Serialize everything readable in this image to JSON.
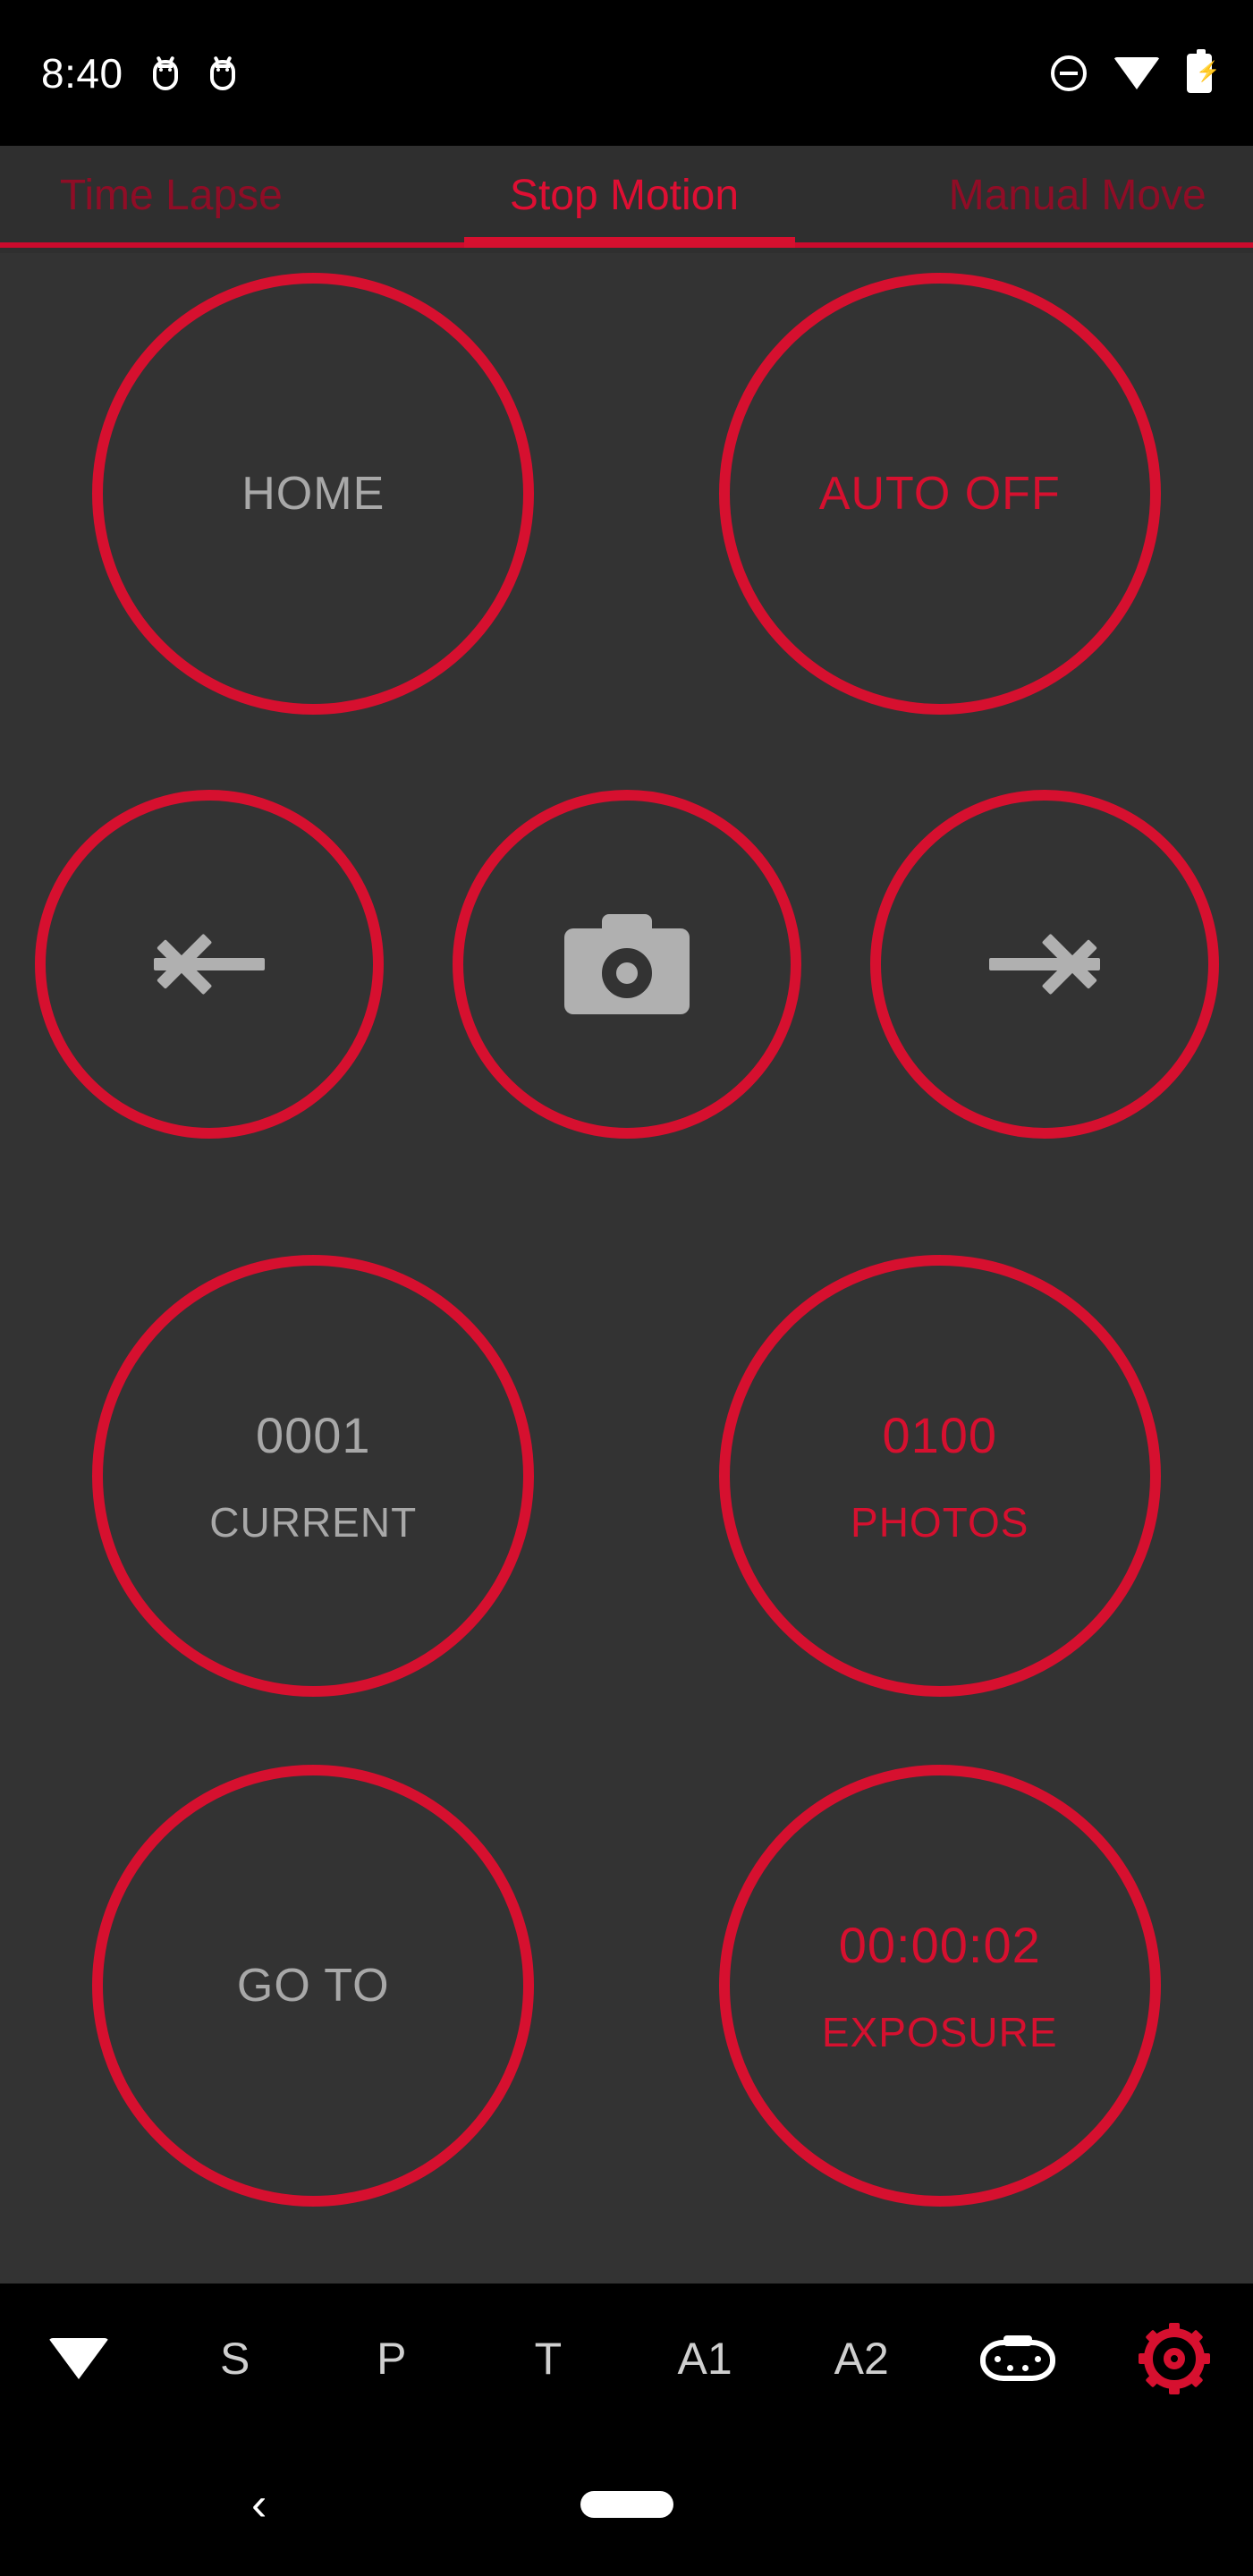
{
  "status_bar": {
    "time": "8:40",
    "left_icons": [
      "android-notification-icon",
      "android-notification-icon"
    ],
    "right_icons": [
      "do-not-disturb-icon",
      "wifi-icon",
      "battery-charging-icon"
    ]
  },
  "tabs": {
    "items": [
      {
        "label": "Time Lapse",
        "active": false
      },
      {
        "label": "Stop Motion",
        "active": true
      },
      {
        "label": "Manual Move",
        "active": false
      }
    ],
    "active_index": 1
  },
  "controls": {
    "home": {
      "label": "HOME"
    },
    "auto": {
      "label": "AUTO OFF"
    },
    "prev": {
      "icon": "arrow-left-icon"
    },
    "shutter": {
      "icon": "camera-icon"
    },
    "next": {
      "icon": "arrow-right-icon"
    },
    "current": {
      "value": "0001",
      "label": "CURRENT"
    },
    "photos": {
      "value": "0100",
      "label": "PHOTOS"
    },
    "goto": {
      "label": "GO TO"
    },
    "exposure": {
      "value": "00:00:02",
      "label": "EXPOSURE"
    }
  },
  "app_bar": {
    "items": [
      {
        "type": "icon",
        "name": "wifi-icon",
        "label": ""
      },
      {
        "type": "text",
        "name": "s-button",
        "label": "S"
      },
      {
        "type": "text",
        "name": "p-button",
        "label": "P"
      },
      {
        "type": "text",
        "name": "t-button",
        "label": "T"
      },
      {
        "type": "text",
        "name": "a1-button",
        "label": "A1"
      },
      {
        "type": "text",
        "name": "a2-button",
        "label": "A2"
      },
      {
        "type": "icon",
        "name": "gamepad-icon",
        "label": ""
      },
      {
        "type": "icon",
        "name": "settings-gear-icon",
        "label": ""
      }
    ]
  },
  "nav_bar": {
    "back_glyph": "‹",
    "home_indicator": "home-pill"
  },
  "colors": {
    "accent_red": "#d6102f",
    "inactive_red": "#8f0d26",
    "background": "#333333",
    "tab_background": "#2f2f2f",
    "text_gray": "#a8a8a8",
    "system_black": "#000000"
  }
}
